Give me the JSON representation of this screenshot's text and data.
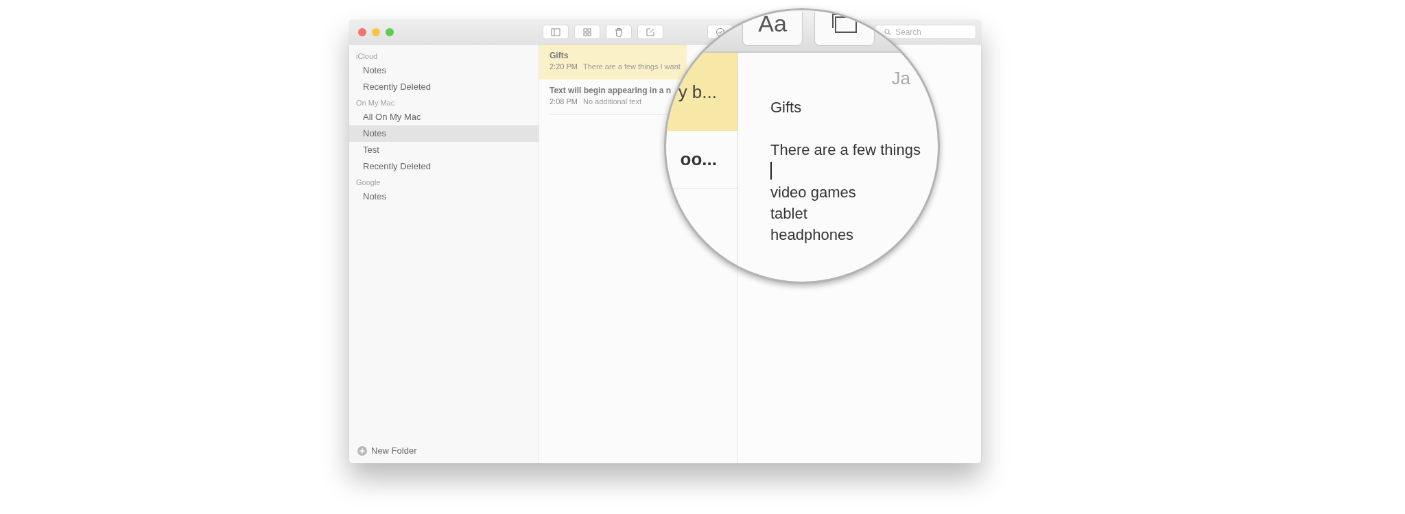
{
  "toolbar": {
    "search": {
      "placeholder": "Search"
    }
  },
  "sidebar": {
    "sections": [
      {
        "title": "iCloud",
        "items": [
          {
            "label": "Notes",
            "selected": false
          },
          {
            "label": "Recently Deleted",
            "selected": false
          }
        ]
      },
      {
        "title": "On My Mac",
        "items": [
          {
            "label": "All On My Mac",
            "selected": false
          },
          {
            "label": "Notes",
            "selected": true
          },
          {
            "label": "Test",
            "selected": false
          },
          {
            "label": "Recently Deleted",
            "selected": false
          }
        ]
      },
      {
        "title": "Google",
        "items": [
          {
            "label": "Notes",
            "selected": false
          }
        ]
      }
    ],
    "new_folder": "New Folder"
  },
  "notes_list": [
    {
      "title": "Gifts",
      "time": "2:20 PM",
      "preview": "There are a few things I want",
      "selected": true
    },
    {
      "title": "Text will begin appearing in a n",
      "time": "2:08 PM",
      "preview": "No additional text",
      "selected": false
    }
  ],
  "magnifier": {
    "format_button": "Aa",
    "list_fragments": [
      {
        "text": "y b...",
        "selected": true
      },
      {
        "text": "oo...",
        "selected": false
      }
    ],
    "date_fragment": "Ja",
    "note": {
      "title": "Gifts",
      "lines": [
        "There are a few things",
        "video games",
        "tablet",
        "headphones"
      ]
    }
  }
}
